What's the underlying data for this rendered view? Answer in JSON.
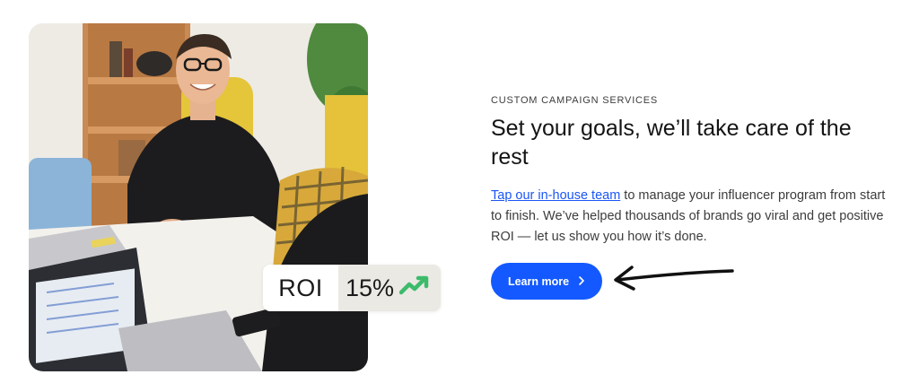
{
  "photo": {
    "alt": "Smiling man at a meeting table with laptops"
  },
  "roi_badge": {
    "label": "ROI",
    "value": "15%",
    "icon": "trend-up-icon",
    "icon_color": "#3dbb6b"
  },
  "eyebrow": "CUSTOM CAMPAIGN SERVICES",
  "headline": "Set your goals, we’ll take care of the rest",
  "body": {
    "link_text": "Tap our in-house team",
    "rest_text": " to manage your influencer program from start to finish. We’ve helped thousands of brands go viral and get positive ROI — let us show you how it’s done."
  },
  "cta": {
    "label": "Learn more",
    "icon": "chevron-right-icon"
  },
  "colors": {
    "accent": "#1459ff",
    "link": "#1a55f5"
  }
}
